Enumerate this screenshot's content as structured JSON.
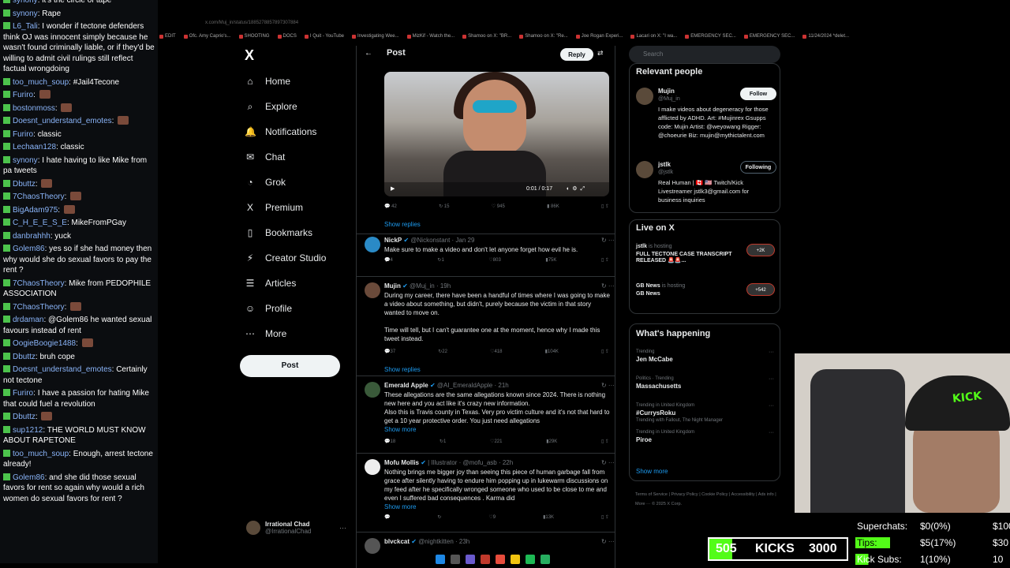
{
  "chat": [
    {
      "user": "synony",
      "msg": "it's the circle of tape"
    },
    {
      "user": "synony",
      "msg": "Rape"
    },
    {
      "user": "L6_Tali",
      "msg": "I wonder if tectone defenders think OJ was innocent simply because he wasn't found criminally liable, or if they'd be willing to admit civil rulings still reflect factual wrongdoing"
    },
    {
      "user": "too_much_soup",
      "msg": "#Jail4Tecone"
    },
    {
      "user": "Furiro",
      "msg": ""
    },
    {
      "user": "bostonmoss",
      "msg": ""
    },
    {
      "user": "Doesnt_understand_emotes",
      "msg": ""
    },
    {
      "user": "Furiro",
      "msg": "classic"
    },
    {
      "user": "Lechaan128",
      "msg": "classic"
    },
    {
      "user": "synony",
      "msg": "I hate having to like Mike from pa tweets"
    },
    {
      "user": "Dbuttz",
      "msg": ""
    },
    {
      "user": "7ChaosTheory",
      "msg": ""
    },
    {
      "user": "BigAdam975",
      "msg": ""
    },
    {
      "user": "C_H_E_E_S_E",
      "msg": "MikeFromPGay"
    },
    {
      "user": "danbrahhh",
      "msg": "yuck"
    },
    {
      "user": "Golem86",
      "msg": "yes so if she had money then why would she do sexual favors to pay the rent ?"
    },
    {
      "user": "7ChaosTheory",
      "msg": "Mike from PEDOPHILE ASSOCIATION"
    },
    {
      "user": "7ChaosTheory",
      "msg": ""
    },
    {
      "user": "drdaman",
      "msg": "@Golem86 he wanted sexual favours instead of rent"
    },
    {
      "user": "OogieBoogie1488",
      "msg": ""
    },
    {
      "user": "Dbuttz",
      "msg": "bruh cope"
    },
    {
      "user": "Doesnt_understand_emotes",
      "msg": "Certainly not tectone"
    },
    {
      "user": "Furiro",
      "msg": "I have a passion for hating Mike that could fuel a revolution"
    },
    {
      "user": "Dbuttz",
      "msg": ""
    },
    {
      "user": "sup1212",
      "msg": "THE WORLD MUST KNOW ABOUT RAPETONE"
    },
    {
      "user": "too_much_soup",
      "msg": "Enough, arrest tectone already!"
    },
    {
      "user": "Golem86",
      "msg": "and she did those sexual favors for rent so again why would a rich women do sexual favors for rent ?"
    }
  ],
  "browser": {
    "url": "x.com/Muj_in/status/1885278857897307884",
    "bookmarks": [
      "EDIT",
      "Ofc. Amy Caprio's...",
      "SHOOTING",
      "DOCS",
      "I Quit - YouTube",
      "Investigating Wee...",
      "MizKif - Watch the...",
      "Shamoo on X: \"BR...",
      "Shamoo on X: \"Re...",
      "Joe Rogan Experi...",
      "Lacari on X: \"I wa...",
      "EMERGENCY SEC...",
      "EMERGENCY SEC...",
      "11/24/2024 *delet..."
    ]
  },
  "nav": {
    "logo": "X",
    "items": [
      {
        "icon": "⌂",
        "label": "Home"
      },
      {
        "icon": "⌕",
        "label": "Explore"
      },
      {
        "icon": "🔔",
        "label": "Notifications"
      },
      {
        "icon": "✉",
        "label": "Chat"
      },
      {
        "icon": "◔",
        "label": "Grok"
      },
      {
        "icon": "X",
        "label": "Premium"
      },
      {
        "icon": "▯",
        "label": "Bookmarks"
      },
      {
        "icon": "⚡",
        "label": "Creator Studio"
      },
      {
        "icon": "☰",
        "label": "Articles"
      },
      {
        "icon": "☺",
        "label": "Profile"
      },
      {
        "icon": "⋯",
        "label": "More"
      }
    ],
    "post_button": "Post",
    "account": {
      "name": "Irrational Chad",
      "handle": "@IrrationalChad"
    }
  },
  "feed": {
    "back_icon": "←",
    "title": "Post",
    "reply_button": "Reply",
    "video": {
      "time": "0:01 / 0:17"
    },
    "main_actions": {
      "replies": "42",
      "reposts": "15",
      "likes": "945",
      "views": "86K"
    },
    "show_replies_1": "Show replies",
    "tweets": [
      {
        "name": "NickP",
        "handle": "@Nickonstant · Jan 29",
        "text": "Make sure to make a video and don't let anyone forget how evil he is.",
        "replies": "4",
        "reposts": "1",
        "likes": "803",
        "views": "75K",
        "color": "#2a8ac6"
      },
      {
        "name": "Mujin",
        "handle": "@Muj_in · 19h",
        "text": "During my career, there have been a handful of times where I was going to make a video about something, but didn't, purely because the victim in that story wanted to move on.\n\nTime will tell, but I can't guarantee one at the moment, hence why I made this tweet instead.",
        "replies": "37",
        "reposts": "22",
        "likes": "418",
        "views": "104K",
        "color": "#6a4a3a"
      },
      {
        "name": "Emerald Apple",
        "handle": "@AI_EmeraldApple · 21h",
        "text": "These allegations are the same allegations known since 2024. There is nothing new here and you act like it's crazy new information.\nAlso this is Travis county in Texas. Very pro victim culture and it's not that hard to get a 10 year protective order. You just need allegations",
        "show_more": "Show more",
        "replies": "18",
        "reposts": "1",
        "likes": "221",
        "views": "29K",
        "color": "#3a5a3a"
      },
      {
        "name": "Mofu Mollis",
        "handle": "| Illustrator · @mofu_asb · 22h",
        "text": "Nothing brings me bigger joy than seeing this piece of human garbage fall from grace after silently having to endure him popping up in lukewarm discussions on my feed after he specifically wronged someone who used to be close to me and even I suffered bad consequences . Karma did",
        "show_more": "Show more",
        "replies": "",
        "reposts": "",
        "likes": "9",
        "views": "13K",
        "color": "#eeeeee"
      },
      {
        "name": "blvckcat",
        "handle": "@nightkitten · 23h",
        "text": "",
        "color": "#555555"
      }
    ],
    "show_replies_2": "Show replies"
  },
  "right": {
    "search_placeholder": "Search",
    "relevant_title": "Relevant people",
    "people": [
      {
        "name": "Mujin",
        "handle": "@Muj_in",
        "button": "Follow",
        "bio": "I make videos about degeneracy for those afflicted by ADHD. Art: #Mujinrex Gsupps code: Mujin Artist: @weyowang Rigger: @choeurie Biz: mujin@mythictalent.com"
      },
      {
        "name": "jstlk",
        "handle": "@jstlk",
        "button": "Following",
        "bio": "Real Human | 🇨🇦 🇺🇸 Twitch/Kick Livestreamer jstlk3@gmail.com for business inquiries"
      }
    ],
    "live_title": "Live on X",
    "live": [
      {
        "name": "jstlk",
        "status": "is hosting",
        "title": "FULL TECTONE CASE TRANSCRIPT RELEASED 🚨🚨...",
        "count": "+2K"
      },
      {
        "name": "GB News",
        "status": "is hosting",
        "title": "GB News",
        "count": "+542"
      }
    ],
    "happening_title": "What's happening",
    "trends": [
      {
        "cat": "Trending",
        "name": "Jen McCabe",
        "sub": ""
      },
      {
        "cat": "Politics · Trending",
        "name": "Massachusetts",
        "sub": ""
      },
      {
        "cat": "Trending in United Kingdom",
        "name": "#CurrysRoku",
        "sub": "Trending with Fallout, The Night Manager"
      },
      {
        "cat": "Trending in United Kingdom",
        "name": "Piroe",
        "sub": ""
      }
    ],
    "show_more": "Show more",
    "footer": "Terms of Service  |  Privacy Policy  |  Cookie Policy  |  Accessibility  |  Ads info  |  More ···  © 2025 X Corp."
  },
  "stats": {
    "superchats": {
      "label": "Superchats:",
      "value": "$0(0%)",
      "target": "$100"
    },
    "tips": {
      "label": "Tips:",
      "value": "$5(17%)",
      "target": "$30"
    },
    "kicksubs": {
      "label": "Kick Subs:",
      "value": "1(10%)",
      "target": "10"
    }
  },
  "kicks": {
    "count": "505",
    "label": "KICKS",
    "goal": "3000",
    "progress": 0.168
  },
  "colors": {
    "accent": "#1d9bf0",
    "kick_green": "#53fc18",
    "bg": "#000000"
  }
}
